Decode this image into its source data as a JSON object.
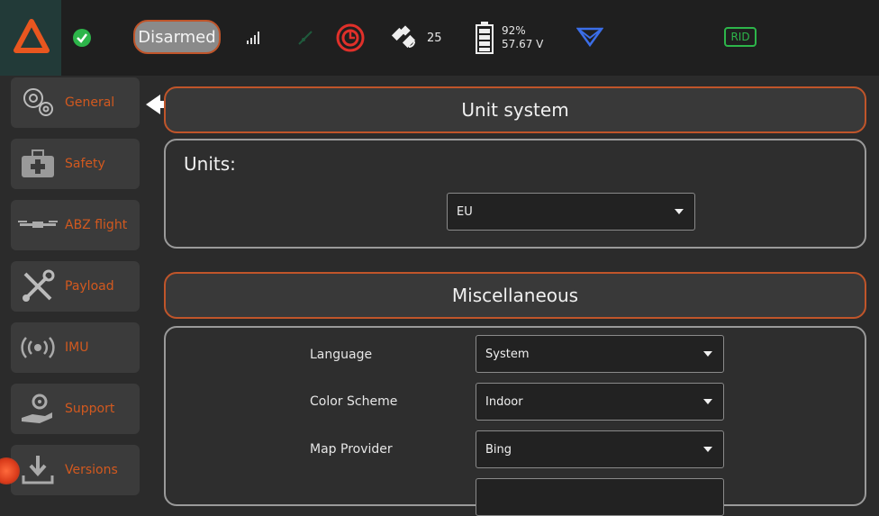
{
  "toolbar": {
    "arm_state": "Disarmed",
    "satellite_count": "25",
    "battery_percent": "92%",
    "battery_voltage": "57.67 V",
    "rid_label": "RID"
  },
  "sidebar": {
    "items": [
      {
        "label": "General",
        "icon": "gears-icon"
      },
      {
        "label": "Safety",
        "icon": "first-aid-kit-icon"
      },
      {
        "label": "ABZ flight",
        "icon": "drone-icon"
      },
      {
        "label": "Payload",
        "icon": "tools-icon"
      },
      {
        "label": "IMU",
        "icon": "broadcast-icon"
      },
      {
        "label": "Support",
        "icon": "hand-gear-icon"
      },
      {
        "label": "Versions",
        "icon": "download-icon"
      }
    ]
  },
  "unit_system": {
    "title": "Unit system",
    "units_label": "Units:",
    "units_value": "EU"
  },
  "misc": {
    "title": "Miscellaneous",
    "rows": [
      {
        "label": "Language",
        "value": "System"
      },
      {
        "label": "Color Scheme",
        "value": "Indoor"
      },
      {
        "label": "Map Provider",
        "value": "Bing"
      }
    ]
  },
  "colors": {
    "accent": "#c0552a",
    "sidebar_label": "#d2591f",
    "ok_green": "#2db54a",
    "alert_red": "#e0302a",
    "nav_blue": "#3b6ee8"
  }
}
